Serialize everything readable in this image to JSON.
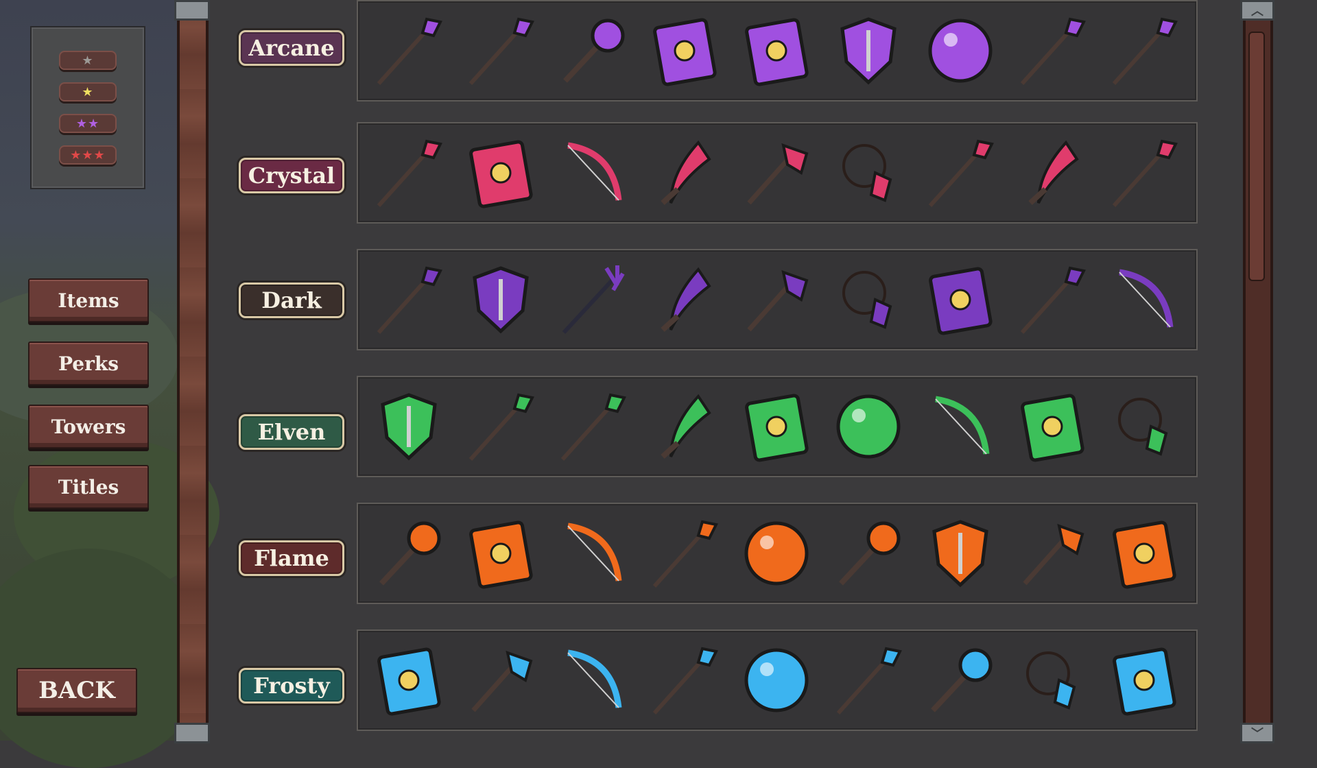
{
  "filter": {
    "rarities": [
      {
        "stars": "★",
        "color": "#9c9a96"
      },
      {
        "stars": "★",
        "color": "#f0e060"
      },
      {
        "stars": "★★",
        "color": "#b060e0"
      },
      {
        "stars": "★★★",
        "color": "#e04848"
      }
    ]
  },
  "nav": {
    "items": "Items",
    "perks": "Perks",
    "towers": "Towers",
    "titles": "Titles",
    "back": "BACK"
  },
  "scroll": {
    "up": "︿",
    "down": "﹀"
  },
  "categories": [
    {
      "name": "Arcane",
      "tag_color": "#5a3452",
      "accent": "#a050e0",
      "items": [
        "arcane-spear-icon",
        "arcane-staff-icon",
        "arcane-mace-icon",
        "arcane-tome-icon",
        "arcane-spellbook-icon",
        "arcane-shield-icon",
        "arcane-orb-icon",
        "arcane-scepter-icon",
        "arcane-sword-icon"
      ]
    },
    {
      "name": "Crystal",
      "tag_color": "#6a2a44",
      "accent": "#e03c6c",
      "items": [
        "crystal-dagger-icon",
        "crystal-tome-icon",
        "crystal-bow-icon",
        "crystal-sickle-icon",
        "crystal-axe-icon",
        "crystal-amulet-icon",
        "crystal-spear-icon",
        "crystal-claws-icon",
        "crystal-sword-icon"
      ]
    },
    {
      "name": "Dark",
      "tag_color": "#3a2f2b",
      "accent": "#7a3cc0",
      "items": [
        "dark-sword-icon",
        "dark-shield-icon",
        "dark-trident-icon",
        "dark-scythe-icon",
        "dark-axe-icon",
        "dark-amulet-icon",
        "dark-skull-tome-icon",
        "dark-spear-icon",
        "dark-bow-icon"
      ]
    },
    {
      "name": "Elven",
      "tag_color": "#2f5a46",
      "accent": "#3cc05a",
      "items": [
        "elven-shield-icon",
        "elven-staff-icon",
        "elven-spear-icon",
        "elven-sickle-icon",
        "elven-tome-icon",
        "elven-orb-icon",
        "elven-bow-icon",
        "elven-spellbook-icon",
        "elven-bracelet-icon"
      ]
    },
    {
      "name": "Flame",
      "tag_color": "#5e2b2b",
      "accent": "#f06a1c",
      "items": [
        "flame-torch-icon",
        "flame-tome-icon",
        "flame-bow-icon",
        "flame-spear-icon",
        "flame-orb-icon",
        "flame-mace-icon",
        "flame-shield-icon",
        "flame-axe-icon",
        "flame-spellbook-icon"
      ]
    },
    {
      "name": "Frosty",
      "tag_color": "#1f5a58",
      "accent": "#3cb4f0",
      "items": [
        "frosty-tome-icon",
        "frosty-axe-icon",
        "frosty-bow-icon",
        "frosty-spear-icon",
        "frosty-orb-icon",
        "frosty-dagger-icon",
        "frosty-gauntlet-icon",
        "frosty-amulet-icon",
        "frosty-spellbook-icon"
      ]
    }
  ]
}
